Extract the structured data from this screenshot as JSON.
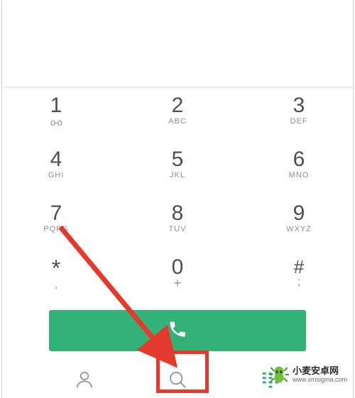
{
  "keypad": {
    "r1": [
      {
        "num": "1",
        "sub_type": "vm",
        "sub": "ᴼᴼ"
      },
      {
        "num": "2",
        "sub_type": "txt",
        "sub": "ABC"
      },
      {
        "num": "3",
        "sub_type": "txt",
        "sub": "DEF"
      }
    ],
    "r2": [
      {
        "num": "4",
        "sub_type": "txt",
        "sub": "GHI"
      },
      {
        "num": "5",
        "sub_type": "txt",
        "sub": "JKL"
      },
      {
        "num": "6",
        "sub_type": "txt",
        "sub": "MNO"
      }
    ],
    "r3": [
      {
        "num": "7",
        "sub_type": "txt",
        "sub": "PQRS"
      },
      {
        "num": "8",
        "sub_type": "txt",
        "sub": "TUV"
      },
      {
        "num": "9",
        "sub_type": "txt",
        "sub": "WXYZ"
      }
    ],
    "r4": [
      {
        "num": "*",
        "sub_type": "sym",
        "sub": ","
      },
      {
        "num": "0",
        "sub_type": "plus",
        "sub": "+"
      },
      {
        "num": "#",
        "sub_type": "sym",
        "sub": ";"
      }
    ]
  },
  "watermark": {
    "line1": "小麦安卓网",
    "line2": "www.xmsigma.com"
  },
  "colors": {
    "accent": "#33b278",
    "annotation": "#e43a2e"
  }
}
